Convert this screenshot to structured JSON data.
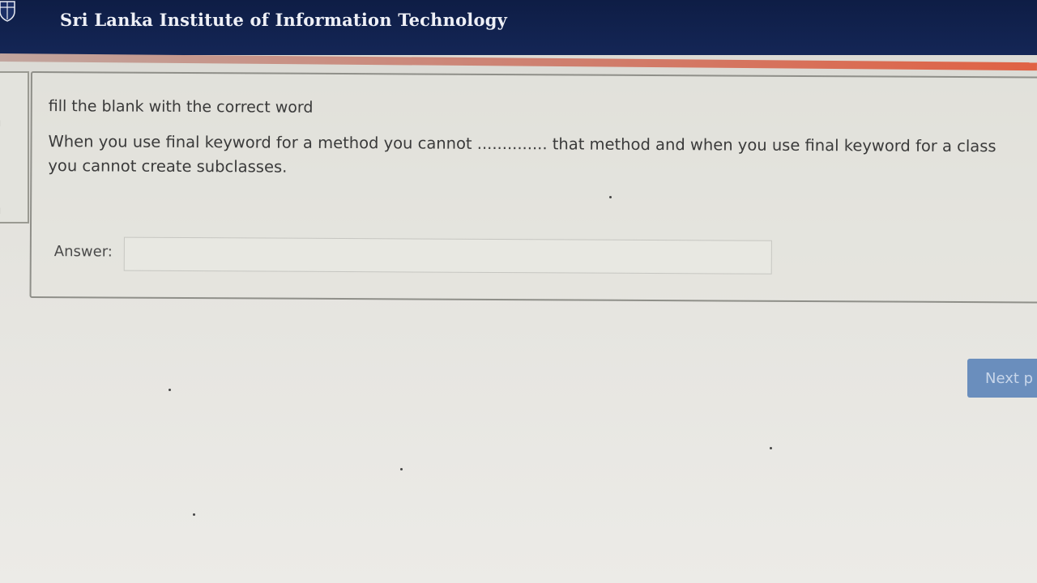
{
  "header": {
    "institute_name": "Sri Lanka Institute of Information Technology",
    "background_color": "#0e1d45",
    "accent_color": "#e06244",
    "logo_icon": "university-crest-icon"
  },
  "question": {
    "instruction": "fill the blank with the correct word",
    "line1": "When you use final keyword for a method you cannot .............. that method and when you use final keyword for a class",
    "line2": "you cannot create subclasses."
  },
  "answer": {
    "label": "Answer:",
    "value": ""
  },
  "navigation": {
    "next_label": "Next p",
    "button_color": "#6a8ebd"
  }
}
